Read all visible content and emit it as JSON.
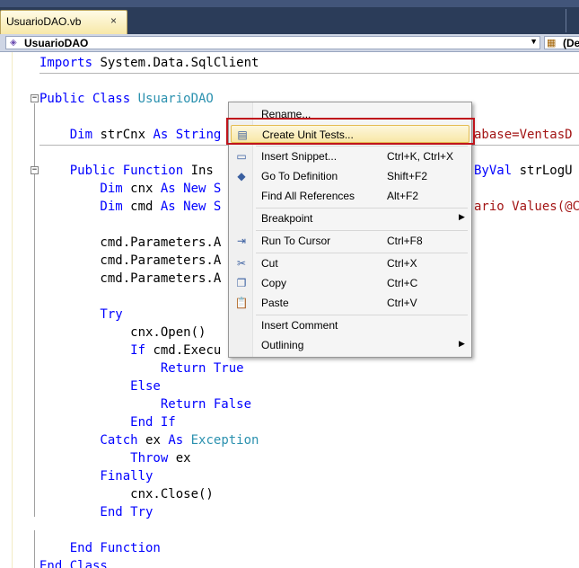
{
  "tab": {
    "title": "UsuarioDAO.vb",
    "close_glyph": "×"
  },
  "navbar": {
    "class_name": "UsuarioDAO",
    "member_name": "(De"
  },
  "code": [
    {
      "parts": [
        {
          "t": "Imports ",
          "c": "kw"
        },
        {
          "t": "System.Data.SqlClient",
          "c": ""
        }
      ]
    },
    {
      "parts": []
    },
    {
      "parts": [
        {
          "t": "Public Class ",
          "c": "kw"
        },
        {
          "t": "UsuarioDAO",
          "c": "ty"
        }
      ]
    },
    {
      "parts": []
    },
    {
      "parts": [
        {
          "t": "    Dim ",
          "c": "kw"
        },
        {
          "t": "strCnx ",
          "c": ""
        },
        {
          "t": "As String",
          "c": "kw"
        }
      ]
    },
    {
      "parts": []
    },
    {
      "parts": [
        {
          "t": "    Public Function ",
          "c": "kw"
        },
        {
          "t": "Ins",
          "c": ""
        }
      ]
    },
    {
      "parts": [
        {
          "t": "        Dim ",
          "c": "kw"
        },
        {
          "t": "cnx ",
          "c": ""
        },
        {
          "t": "As New S",
          "c": "kw"
        }
      ]
    },
    {
      "parts": [
        {
          "t": "        Dim ",
          "c": "kw"
        },
        {
          "t": "cmd ",
          "c": ""
        },
        {
          "t": "As New S",
          "c": "kw"
        }
      ]
    },
    {
      "parts": []
    },
    {
      "parts": [
        {
          "t": "        cmd.Parameters.A",
          "c": ""
        }
      ]
    },
    {
      "parts": [
        {
          "t": "        cmd.Parameters.A",
          "c": ""
        }
      ]
    },
    {
      "parts": [
        {
          "t": "        cmd.Parameters.A",
          "c": ""
        }
      ]
    },
    {
      "parts": []
    },
    {
      "parts": [
        {
          "t": "        Try",
          "c": "kw"
        }
      ]
    },
    {
      "parts": [
        {
          "t": "            cnx.Open()",
          "c": ""
        }
      ]
    },
    {
      "parts": [
        {
          "t": "            If ",
          "c": "kw"
        },
        {
          "t": "cmd.Execu",
          "c": ""
        }
      ]
    },
    {
      "parts": [
        {
          "t": "                Return True",
          "c": "kw"
        }
      ]
    },
    {
      "parts": [
        {
          "t": "            Else",
          "c": "kw"
        }
      ]
    },
    {
      "parts": [
        {
          "t": "                Return False",
          "c": "kw"
        }
      ]
    },
    {
      "parts": [
        {
          "t": "            End If",
          "c": "kw"
        }
      ]
    },
    {
      "parts": [
        {
          "t": "        Catch ",
          "c": "kw"
        },
        {
          "t": "ex ",
          "c": ""
        },
        {
          "t": "As ",
          "c": "kw"
        },
        {
          "t": "Exception",
          "c": "ty"
        }
      ]
    },
    {
      "parts": [
        {
          "t": "            Throw ",
          "c": "kw"
        },
        {
          "t": "ex",
          "c": ""
        }
      ]
    },
    {
      "parts": [
        {
          "t": "        Finally",
          "c": "kw"
        }
      ]
    },
    {
      "parts": [
        {
          "t": "            cnx.Close()",
          "c": ""
        }
      ]
    },
    {
      "parts": [
        {
          "t": "        End Try",
          "c": "kw"
        }
      ]
    },
    {
      "parts": []
    },
    {
      "parts": [
        {
          "t": "    End Function",
          "c": "kw"
        }
      ]
    },
    {
      "parts": [
        {
          "t": "End Class",
          "c": "kw"
        }
      ]
    }
  ],
  "code_right": {
    "line5": "abase=VentasD",
    "line7_kw": "ByVal ",
    "line7_txt": "strLogU",
    "line9": "ario Values(@C"
  },
  "context_menu": {
    "items": [
      {
        "name": "menu-rename",
        "label": "Rename...",
        "shortcut": "",
        "icon": "",
        "icon_name": "",
        "submenu": false,
        "highlight": false
      },
      {
        "name": "menu-create-unit-tests",
        "label": "Create Unit Tests...",
        "shortcut": "",
        "icon": "▤",
        "icon_name": "unit-test-icon",
        "submenu": false,
        "highlight": true
      },
      {
        "name": "menu-insert-snippet",
        "label": "Insert Snippet...",
        "shortcut": "Ctrl+K, Ctrl+X",
        "icon": "▭",
        "icon_name": "snippet-icon",
        "submenu": false,
        "highlight": false
      },
      {
        "name": "menu-go-to-definition",
        "label": "Go To Definition",
        "shortcut": "Shift+F2",
        "icon": "◆",
        "icon_name": "go-to-definition-icon",
        "submenu": false,
        "highlight": false
      },
      {
        "name": "menu-find-all-references",
        "label": "Find All References",
        "shortcut": "Alt+F2",
        "icon": "",
        "icon_name": "",
        "submenu": false,
        "highlight": false
      },
      {
        "name": "menu-breakpoint",
        "label": "Breakpoint",
        "shortcut": "",
        "icon": "",
        "icon_name": "",
        "submenu": true,
        "highlight": false
      },
      {
        "name": "menu-run-to-cursor",
        "label": "Run To Cursor",
        "shortcut": "Ctrl+F8",
        "icon": "⇥",
        "icon_name": "run-to-cursor-icon",
        "submenu": false,
        "highlight": false
      },
      {
        "name": "menu-cut",
        "label": "Cut",
        "shortcut": "Ctrl+X",
        "icon": "✂",
        "icon_name": "cut-icon",
        "submenu": false,
        "highlight": false
      },
      {
        "name": "menu-copy",
        "label": "Copy",
        "shortcut": "Ctrl+C",
        "icon": "❐",
        "icon_name": "copy-icon",
        "submenu": false,
        "highlight": false
      },
      {
        "name": "menu-paste",
        "label": "Paste",
        "shortcut": "Ctrl+V",
        "icon": "📋",
        "icon_name": "paste-icon",
        "submenu": false,
        "highlight": false
      },
      {
        "name": "menu-insert-comment",
        "label": "Insert Comment",
        "shortcut": "",
        "icon": "",
        "icon_name": "",
        "submenu": false,
        "highlight": false
      },
      {
        "name": "menu-outlining",
        "label": "Outlining",
        "shortcut": "",
        "icon": "",
        "icon_name": "",
        "submenu": true,
        "highlight": false
      }
    ]
  },
  "colors": {
    "keyword": "#0000ff",
    "type": "#2b91af",
    "string": "#a31515",
    "highlight_border": "#c0141c"
  }
}
